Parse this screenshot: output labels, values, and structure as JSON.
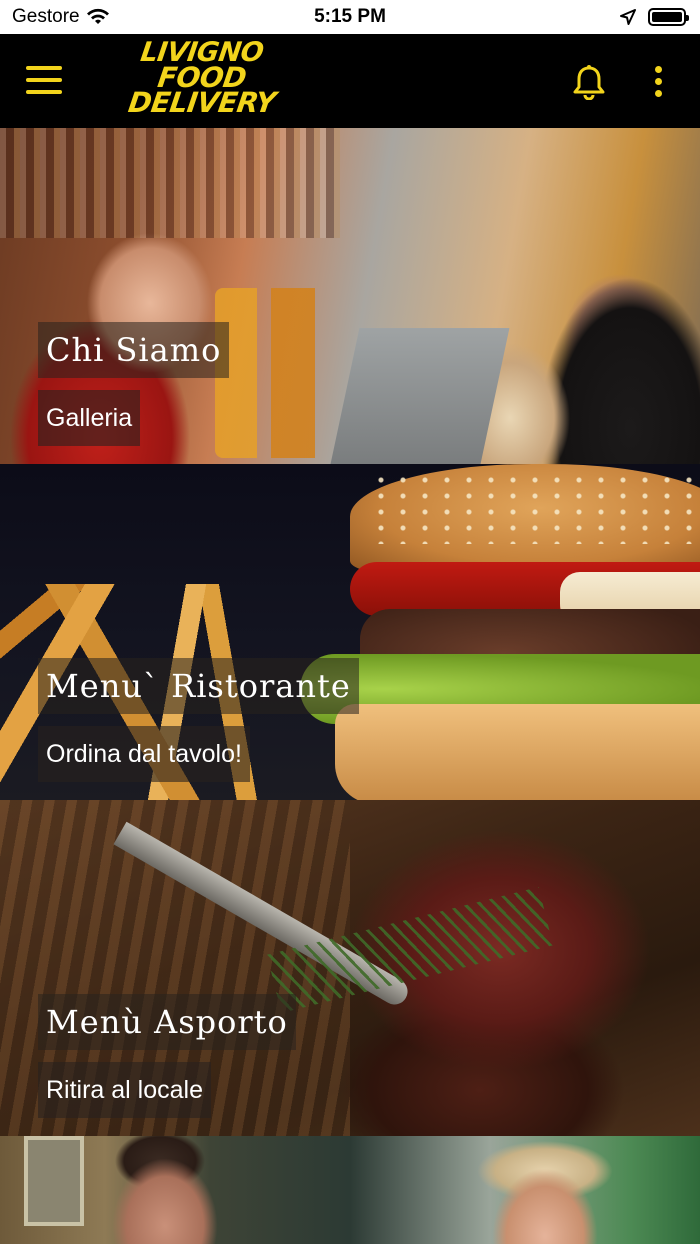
{
  "status_bar": {
    "carrier": "Gestore",
    "time": "5:15 PM"
  },
  "app_bar": {
    "logo_line1": "LIVIGNO",
    "logo_line2": "FOOD",
    "logo_line3": "DELIVERY"
  },
  "tiles": [
    {
      "title": "Chi Siamo",
      "subtitle": "Galleria"
    },
    {
      "title": "Menu` Ristorante",
      "subtitle": "Ordina dal tavolo!"
    },
    {
      "title": "Menù Asporto",
      "subtitle": "Ritira al locale"
    },
    {
      "title": "",
      "subtitle": ""
    }
  ],
  "colors": {
    "accent": "#f2d41c",
    "app_bar_bg": "#000000",
    "status_bar_bg": "#ffffff"
  },
  "icons": {
    "menu": "hamburger-icon",
    "notifications": "bell-icon",
    "more": "more-vertical-icon",
    "wifi": "wifi-icon",
    "location": "location-arrow-icon",
    "battery": "battery-icon"
  }
}
